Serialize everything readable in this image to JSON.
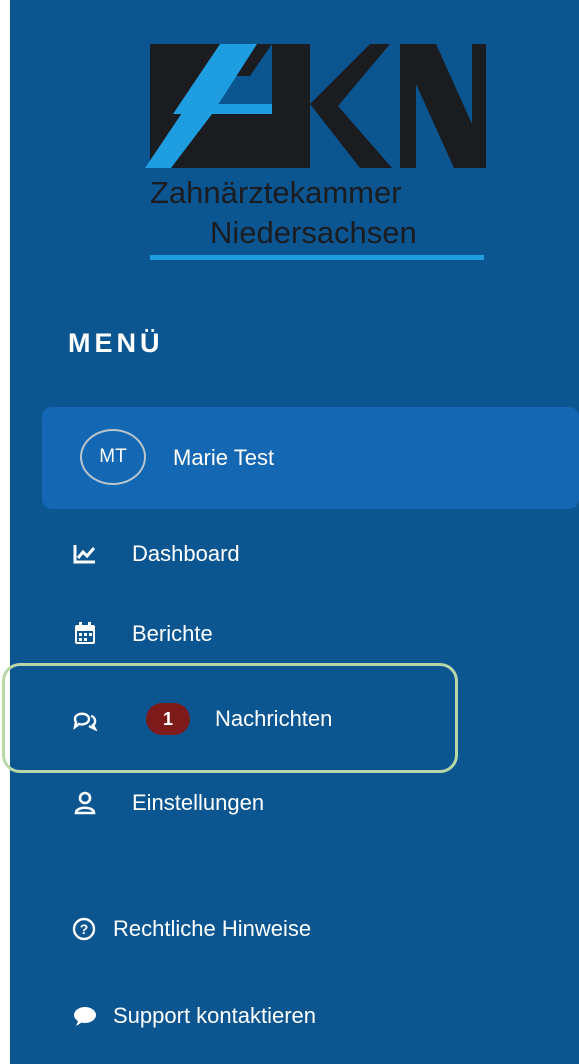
{
  "brand": {
    "logo_text": "ZKN",
    "line1": "Zahnärztekammer",
    "line2": "Niedersachsen",
    "colors": {
      "dark": "#1b1c20",
      "light_blue": "#1e9ee1"
    }
  },
  "menu": {
    "title": "MENÜ",
    "user": {
      "initials": "MT",
      "name": "Marie Test"
    },
    "items": [
      {
        "label": "Dashboard",
        "icon": "chart-line-icon"
      },
      {
        "label": "Berichte",
        "icon": "calendar-icon"
      },
      {
        "label": "Nachrichten",
        "icon": "chat-bubbles-icon",
        "badge": "1",
        "highlighted": true
      },
      {
        "label": "Einstellungen",
        "icon": "user-icon"
      },
      {
        "label": "Rechtliche Hinweise",
        "icon": "help-circle-icon"
      },
      {
        "label": "Support kontaktieren",
        "icon": "speech-bubble-icon"
      }
    ]
  },
  "colors": {
    "sidebar": "#0b5591",
    "active_item": "#1367b3",
    "badge": "#7d1a1a",
    "highlight_border": "#b7d8a6"
  }
}
